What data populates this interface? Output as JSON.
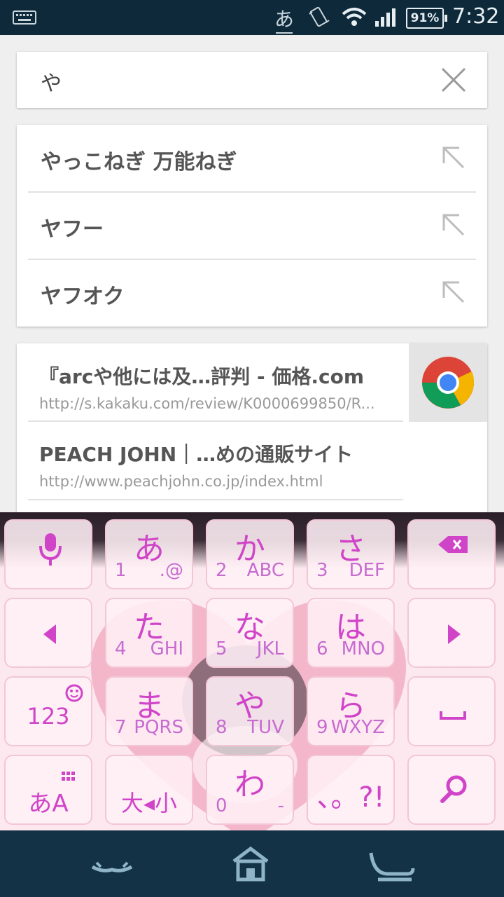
{
  "status": {
    "ime": "あ",
    "battery": "91%",
    "time": "7:32"
  },
  "search": {
    "query": "や"
  },
  "suggestions": [
    {
      "text": "やっこねぎ 万能ねぎ"
    },
    {
      "text": "ヤフー"
    },
    {
      "text": "ヤフオク"
    }
  ],
  "history": [
    {
      "title": "『arcや他には及…評判 - 価格.com",
      "url": "http://s.kakaku.com/review/K0000699850/R..."
    },
    {
      "title": "PEACH JOHN｜…めの通販サイト",
      "url": "http://www.peachjohn.co.jp/index.html"
    }
  ],
  "keyboard": {
    "keys": {
      "a": {
        "big": "あ",
        "num": "1",
        "alp": ".@"
      },
      "ka": {
        "big": "か",
        "num": "2",
        "alp": "ABC"
      },
      "sa": {
        "big": "さ",
        "num": "3",
        "alp": "DEF"
      },
      "ta": {
        "big": "た",
        "num": "4",
        "alp": "GHI"
      },
      "na": {
        "big": "な",
        "num": "5",
        "alp": "JKL"
      },
      "ha": {
        "big": "は",
        "num": "6",
        "alp": "MNO"
      },
      "ma": {
        "big": "ま",
        "num": "7",
        "alp": "PQRS"
      },
      "ya": {
        "big": "や",
        "num": "8",
        "alp": "TUV"
      },
      "ra": {
        "big": "ら",
        "num": "9",
        "alp": "WXYZ"
      },
      "wa": {
        "big": "わ",
        "num": "0",
        "alp": "-"
      },
      "mode_label": "あA",
      "num_label": "123",
      "dakuten_label": "大◂小",
      "punct_label": "、。?!"
    }
  },
  "colors": {
    "keyText": "#d044c8",
    "statusBar": "#0e2a3a",
    "navBar": "#133246"
  },
  "icons": {
    "clear": "close-icon",
    "suggest": "arrow-up-left-icon",
    "mic": "mic-icon",
    "backspace": "backspace-icon",
    "search": "search-icon"
  }
}
